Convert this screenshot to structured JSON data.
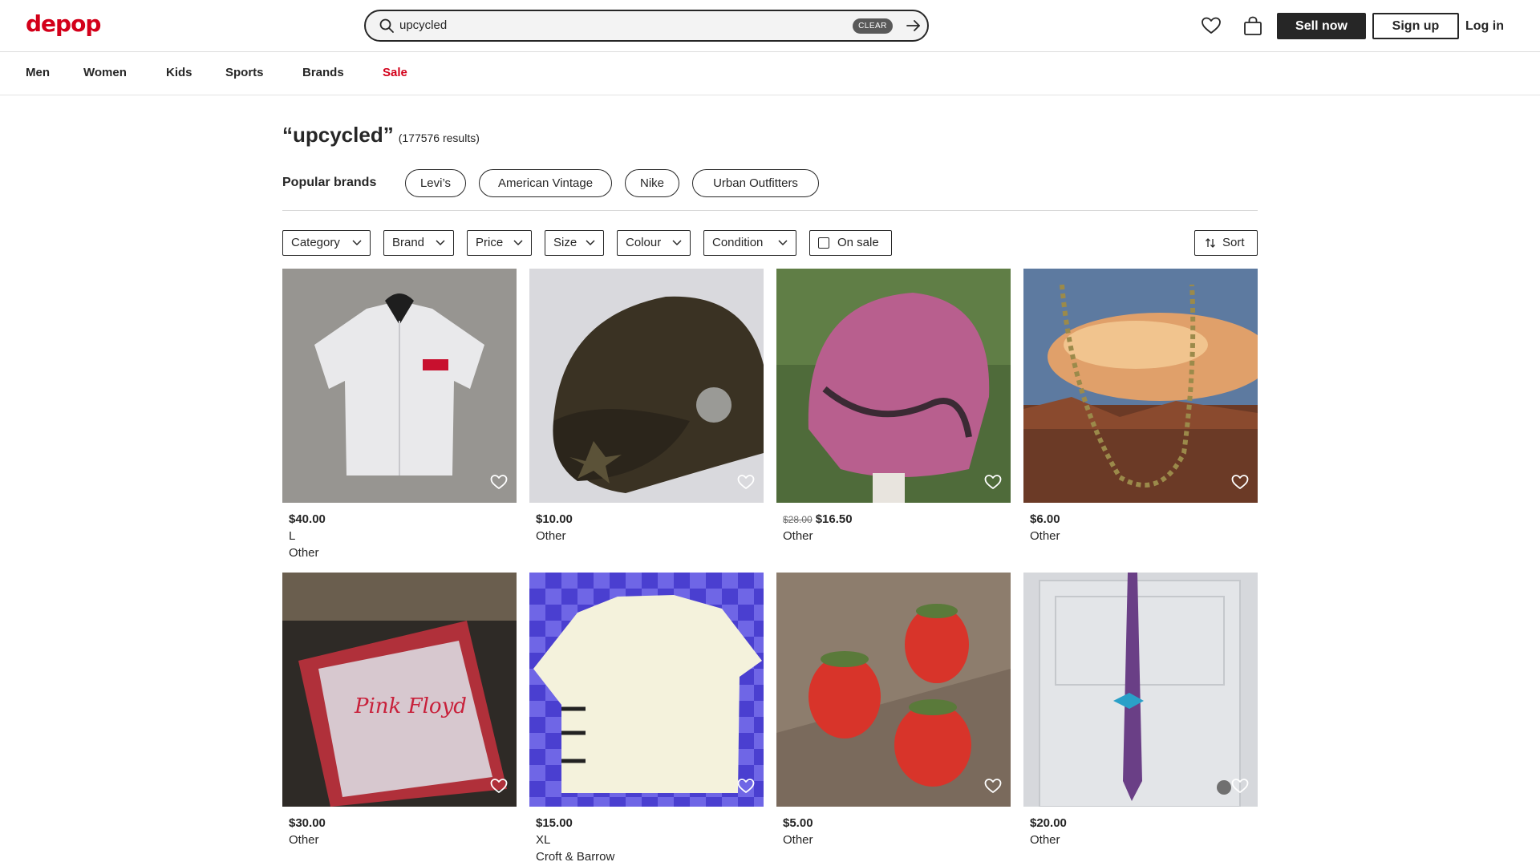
{
  "header": {
    "logo": "depop",
    "search_value": "upcycled",
    "search_clear": "CLEAR",
    "sell_label": "Sell now",
    "signup_label": "Sign up",
    "login_label": "Log in"
  },
  "nav": {
    "items": [
      "Men",
      "Women",
      "Kids",
      "Sports",
      "Brands",
      "Sale"
    ]
  },
  "results": {
    "query": "“upcycled”",
    "count": "(177576 results)"
  },
  "brands": {
    "label": "Popular brands",
    "items": [
      "Levi’s",
      "American Vintage",
      "Nike",
      "Urban Outfitters"
    ]
  },
  "filters": {
    "category": "Category",
    "brand": "Brand",
    "price": "Price",
    "size": "Size",
    "colour": "Colour",
    "condition": "Condition",
    "on_sale": "On sale",
    "sort": "Sort"
  },
  "products": [
    {
      "price": "$40.00",
      "line1": "L",
      "line2": "Other"
    },
    {
      "price": "$10.00",
      "line1": "Other",
      "line2": ""
    },
    {
      "old_price": "$28.00",
      "price": "$16.50",
      "line1": "Other",
      "line2": ""
    },
    {
      "price": "$6.00",
      "line1": "Other",
      "line2": ""
    },
    {
      "price": "$30.00",
      "line1": "Other",
      "line2": ""
    },
    {
      "price": "$15.00",
      "line1": "XL",
      "line2": "Croft & Barrow"
    },
    {
      "price": "$5.00",
      "line1": "Other",
      "line2": ""
    },
    {
      "price": "$20.00",
      "line1": "Other",
      "line2": ""
    }
  ],
  "colors": {
    "brand": "#d3001a",
    "text": "#262626",
    "search_bg": "#f3f3f3"
  },
  "icons": [
    "search-icon",
    "arrow-right-icon",
    "heart-icon",
    "bag-icon",
    "chevron-down-icon",
    "sort-icon",
    "checkbox-icon"
  ]
}
